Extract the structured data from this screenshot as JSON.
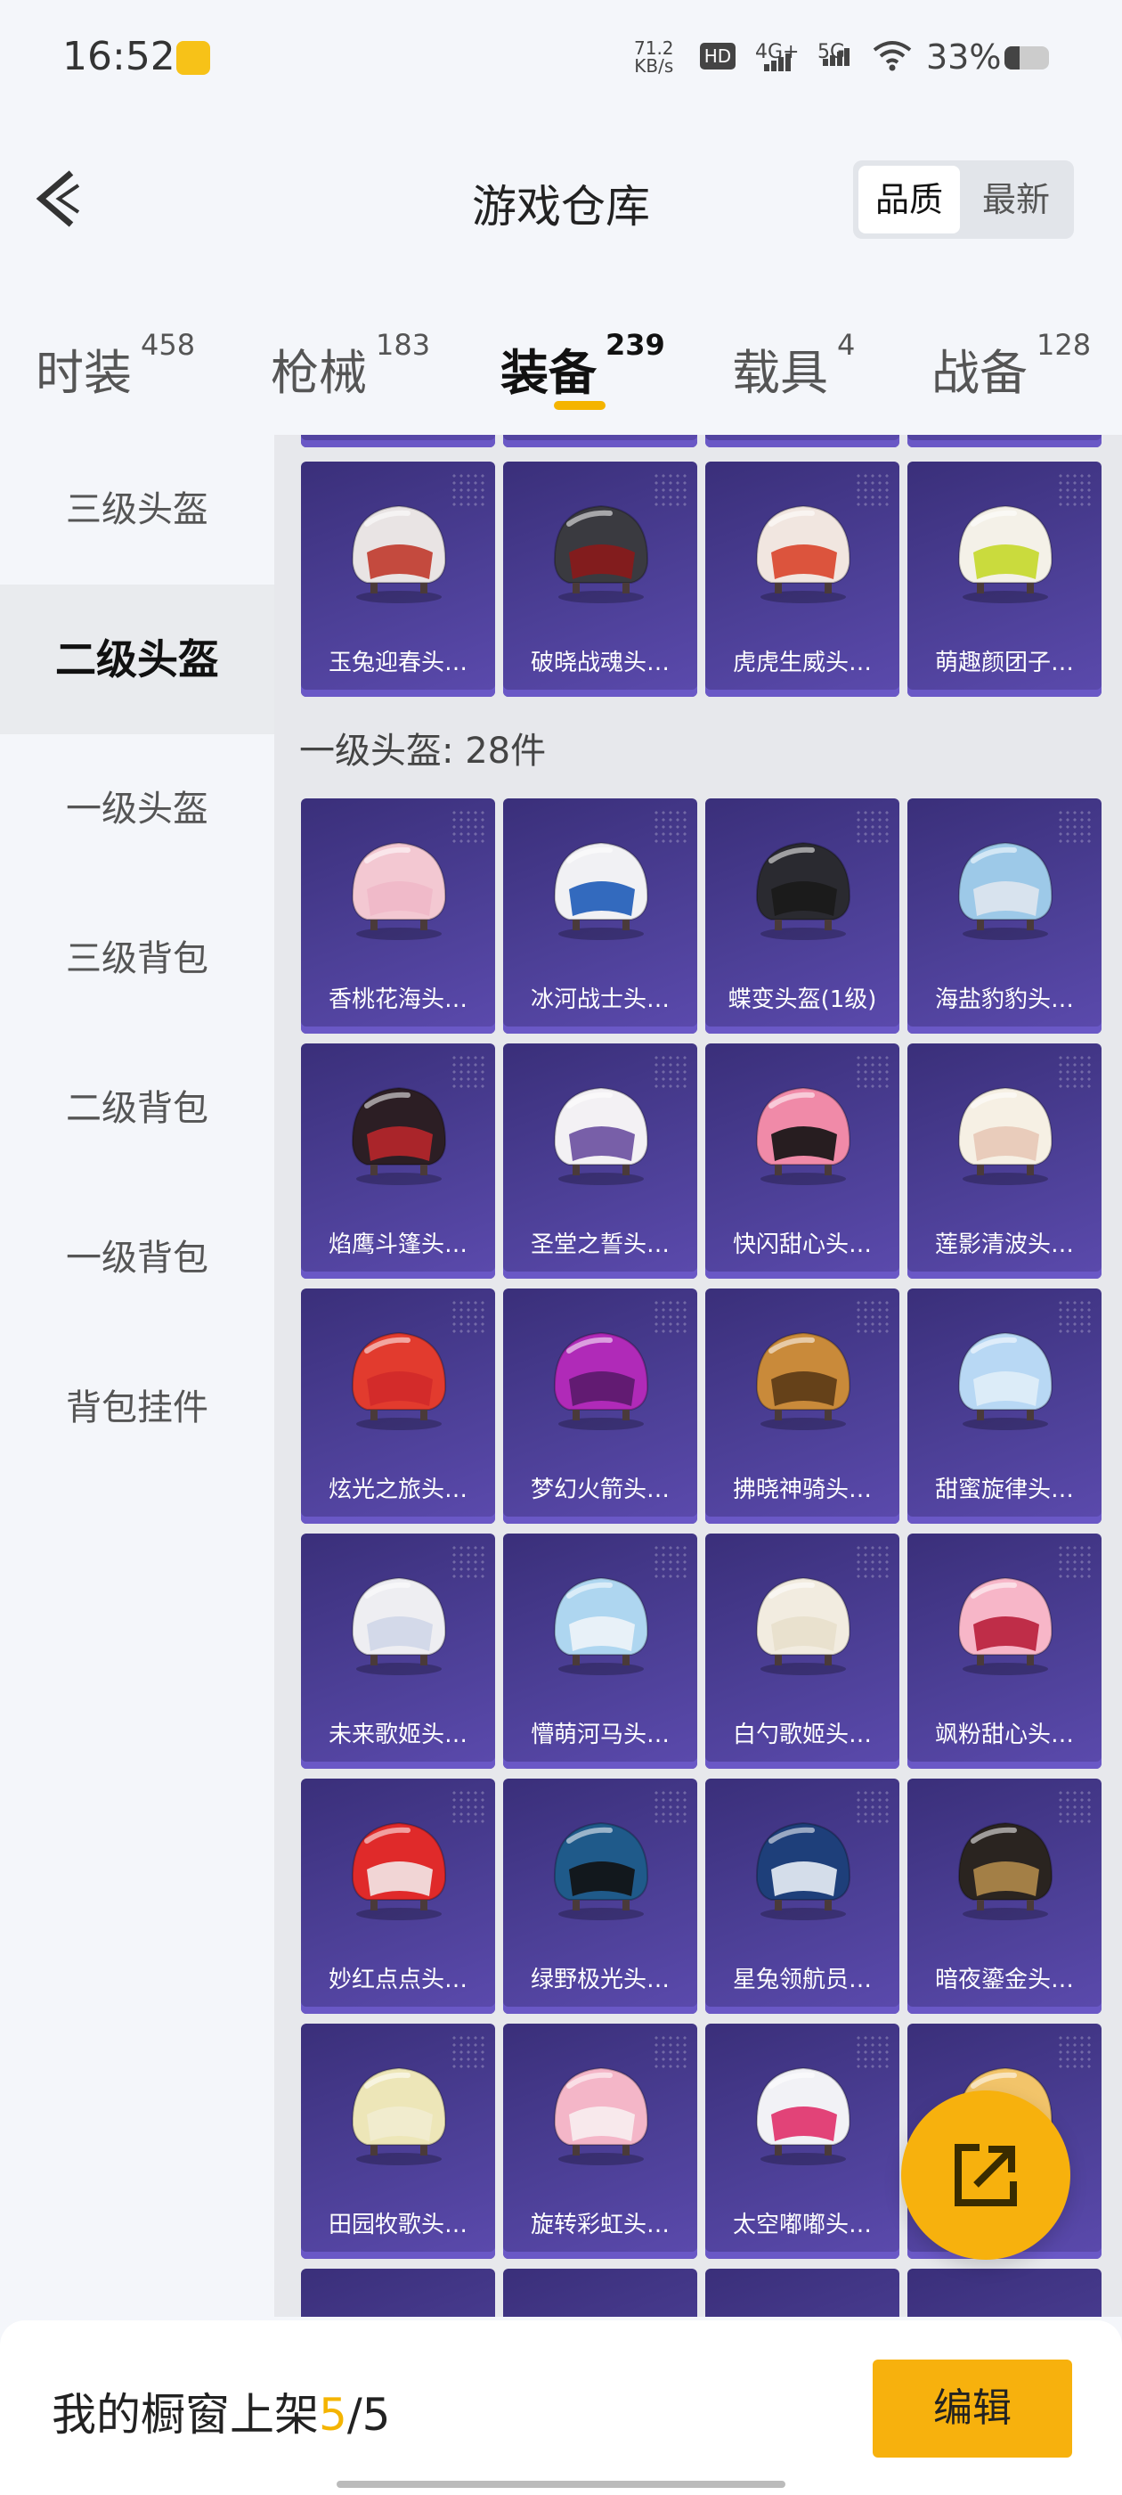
{
  "status_bar": {
    "time": "16:52",
    "net_speed_value": "71.2",
    "net_speed_unit": "KB/s",
    "hd_label": "HD",
    "signal1_label": "4G+",
    "signal2_label": "5G",
    "battery_text": "33%",
    "battery_level": 0.33
  },
  "header": {
    "title": "游戏仓库",
    "sort_options": [
      "品质",
      "最新"
    ],
    "sort_selected": "品质"
  },
  "tabs": [
    {
      "label": "时装",
      "count": "458"
    },
    {
      "label": "枪械",
      "count": "183"
    },
    {
      "label": "装备",
      "count": "239",
      "active": true
    },
    {
      "label": "载具",
      "count": "4"
    },
    {
      "label": "战备",
      "count": "128"
    }
  ],
  "sidebar": {
    "items": [
      {
        "label": "三级头盔"
      },
      {
        "label": "二级头盔",
        "active": true
      },
      {
        "label": "一级头盔"
      },
      {
        "label": "三级背包"
      },
      {
        "label": "二级背包"
      },
      {
        "label": "一级背包"
      },
      {
        "label": "背包挂件"
      }
    ]
  },
  "section_level1": {
    "label": "一级头盔: 28件"
  },
  "top_row": [
    {
      "name": "玉兔迎春头…",
      "color": "#e9e4e4",
      "accent": "#c0392b"
    },
    {
      "name": "破晓战魂头…",
      "color": "#3a3a40",
      "accent": "#8b1a1a"
    },
    {
      "name": "虎虎生威头…",
      "color": "#f1e6e0",
      "accent": "#d9442b"
    },
    {
      "name": "萌趣颜团子…",
      "color": "#f4f1e8",
      "accent": "#c5d82a"
    }
  ],
  "grid": [
    {
      "name": "香桃花海头…",
      "color": "#f3c8d2",
      "visor": "#f0b8c8"
    },
    {
      "name": "冰河战士头…",
      "color": "#f1f1f4",
      "visor": "#1e5bb8"
    },
    {
      "name": "蝶变头盔(1级)",
      "color": "#2a2a30",
      "visor": "#1a1a1a"
    },
    {
      "name": "海盐豹豹头…",
      "color": "#9dc9e8",
      "visor": "#dfe6ee"
    },
    {
      "name": "焰鹰斗篷头…",
      "color": "#2c1e24",
      "visor": "#b8262b"
    },
    {
      "name": "圣堂之誓头…",
      "color": "#f3f1f4",
      "visor": "#6a4fa0"
    },
    {
      "name": "快闪甜心头…",
      "color": "#f08aa8",
      "visor": "#111111"
    },
    {
      "name": "莲影清波头…",
      "color": "#f6f0e4",
      "visor": "#e8c8b6"
    },
    {
      "name": "炫光之旅头…",
      "color": "#e23b2e",
      "visor": "#d22a2a"
    },
    {
      "name": "梦幻火箭头…",
      "color": "#b02ab8",
      "visor": "#5a1a6a"
    },
    {
      "name": "拂晓神骑头…",
      "color": "#c98a3a",
      "visor": "#5a3816"
    },
    {
      "name": "甜蜜旋律头…",
      "color": "#b8d8f4",
      "visor": "#e0eef8"
    },
    {
      "name": "未来歌姬头…",
      "color": "#eeeef2",
      "visor": "#cfd6e8"
    },
    {
      "name": "懵萌河马头…",
      "color": "#aed6f0",
      "visor": "#eef4f8"
    },
    {
      "name": "白勺歌姬头…",
      "color": "#f2ece0",
      "visor": "#e8e0cc"
    },
    {
      "name": "飒粉甜心头…",
      "color": "#f7b6c8",
      "visor": "#b81e3a"
    },
    {
      "name": "妙红点点头…",
      "color": "#e02a2a",
      "visor": "#f3e8e8"
    },
    {
      "name": "绿野极光头…",
      "color": "#1f5a8a",
      "visor": "#111111"
    },
    {
      "name": "星兔领航员…",
      "color": "#1e3f7a",
      "visor": "#e8eef6"
    },
    {
      "name": "暗夜鎏金头…",
      "color": "#2a2420",
      "visor": "#b08a4a"
    },
    {
      "name": "田园牧歌头…",
      "color": "#ede6b8",
      "visor": "#f1ecd0"
    },
    {
      "name": "旋转彩虹头…",
      "color": "#f4b6c8",
      "visor": "#f8eef0"
    },
    {
      "name": "太空嘟嘟头…",
      "color": "#f2f2f6",
      "visor": "#e0306a"
    },
    {
      "name": "",
      "color": "#f2c46a",
      "visor": "#f7e0a0"
    }
  ],
  "bottom_bar": {
    "label": "我的橱窗上架",
    "current": "5",
    "separator": "/",
    "total": "5",
    "edit_button": "编辑"
  }
}
